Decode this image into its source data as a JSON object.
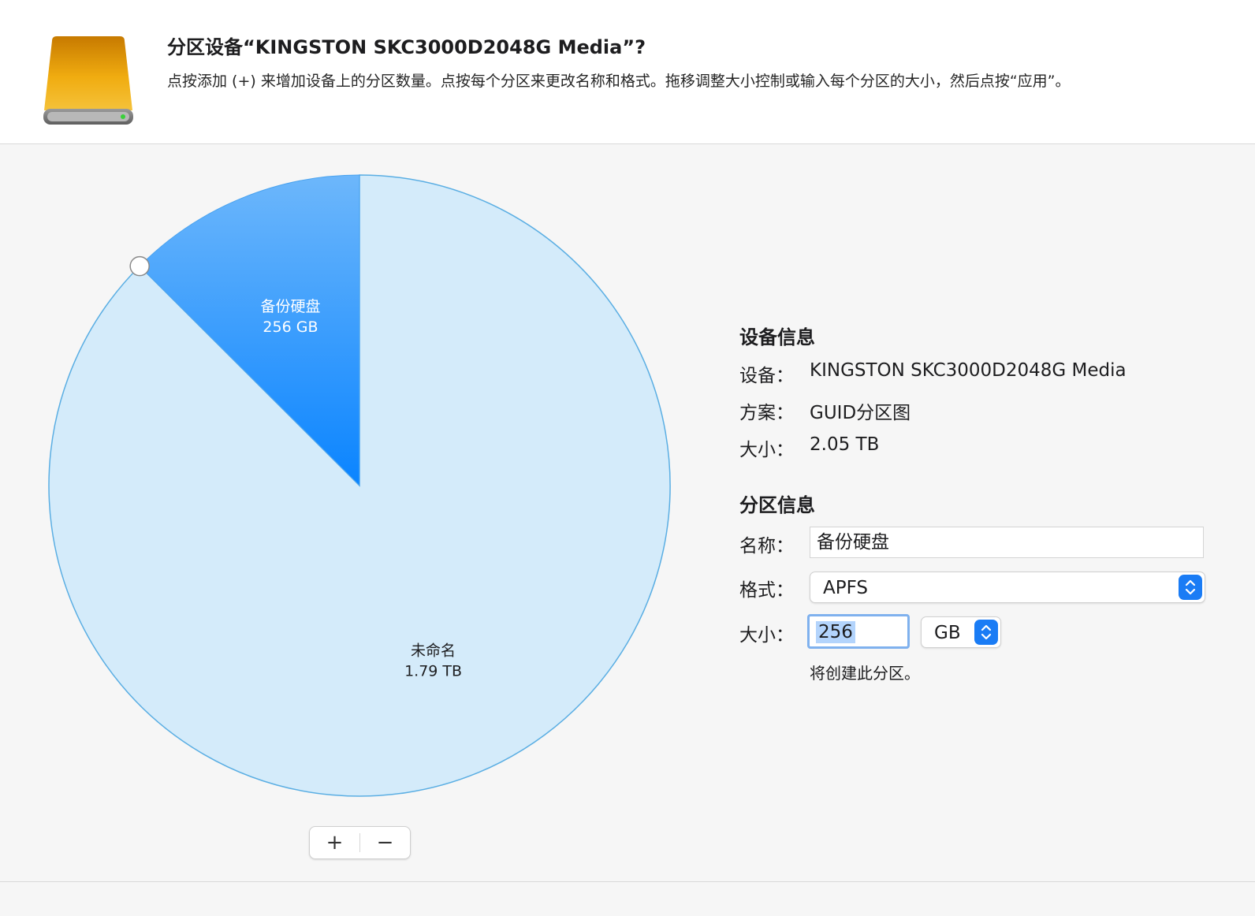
{
  "dialog": {
    "title": "分区设备“KINGSTON SKC3000D2048G Media”?",
    "description": "点按添加 (+) 来增加设备上的分区数量。点按每个分区来更改名称和格式。拖移调整大小控制或输入每个分区的大小，然后点按“应用”。"
  },
  "pie": {
    "partitions": [
      {
        "name": "备份硬盘",
        "size_label": "256 GB",
        "value_gb": 256,
        "color": "#1a8cff",
        "label_color": "#ffffff"
      },
      {
        "name": "未命名",
        "size_label": "1.79 TB",
        "value_gb": 1790,
        "color": "#d4ebfa",
        "label_color": "#1d1d1f"
      }
    ],
    "add_label": "+",
    "remove_label": "−"
  },
  "device_info": {
    "heading": "设备信息",
    "device_label": "设备：",
    "device_value": "KINGSTON SKC3000D2048G Media",
    "scheme_label": "方案：",
    "scheme_value": "GUID分区图",
    "size_label": "大小：",
    "size_value": "2.05 TB"
  },
  "partition_info": {
    "heading": "分区信息",
    "name_label": "名称：",
    "name_value": "备份硬盘",
    "format_label": "格式：",
    "format_value": "APFS",
    "size_label": "大小：",
    "size_value": "256",
    "unit_value": "GB",
    "note": "将创建此分区。"
  },
  "colors": {
    "accent": "#1a7cf5",
    "selected_slice": "#1a8cff",
    "unselected_slice": "#d4ebfa",
    "drive_body": "#e8a40c"
  }
}
